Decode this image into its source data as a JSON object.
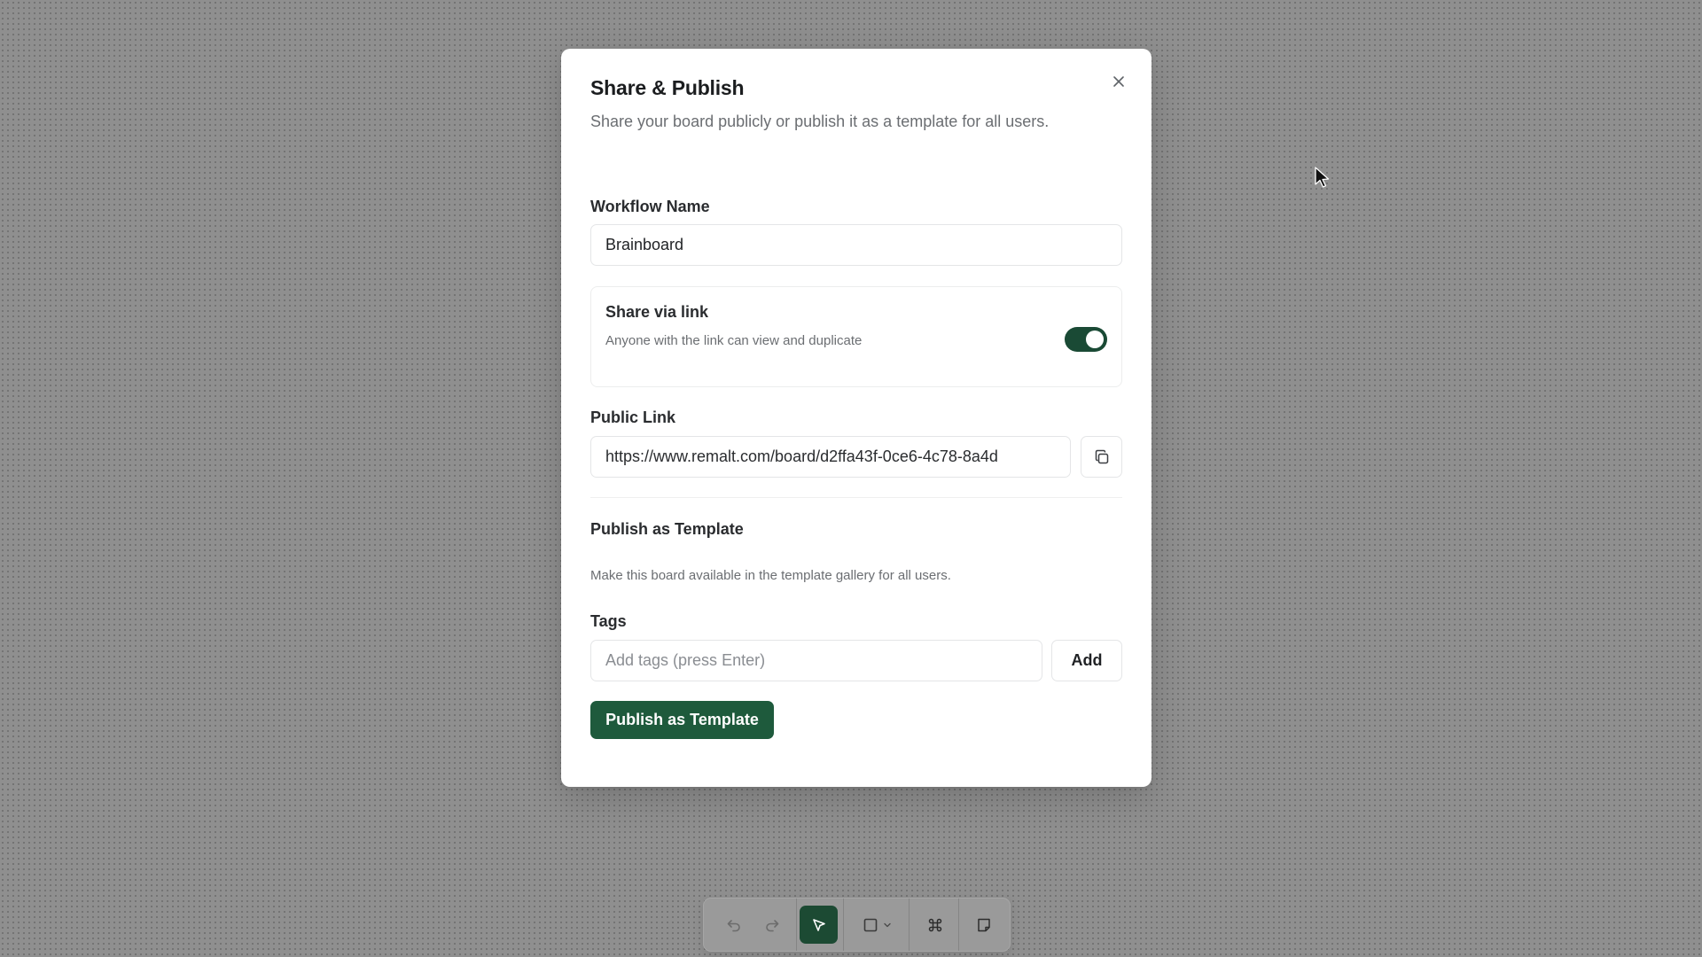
{
  "modal": {
    "title": "Share & Publish",
    "subtitle": "Share your board publicly or publish it as a template for all users.",
    "close_icon": "close-icon"
  },
  "workflow": {
    "label": "Workflow Name",
    "value": "Brainboard"
  },
  "share_link": {
    "title": "Share via link",
    "description": "Anyone with the link can view and duplicate",
    "enabled": true
  },
  "public_link": {
    "label": "Public Link",
    "value": "https://www.remalt.com/board/d2ffa43f-0ce6-4c78-8a4d",
    "copy_icon": "copy-icon"
  },
  "publish_template": {
    "title": "Publish as Template",
    "description": "Make this board available in the template gallery for all users.",
    "tags_label": "Tags",
    "tags_placeholder": "Add tags (press Enter)",
    "add_label": "Add",
    "publish_label": "Publish as Template"
  },
  "toolbar": {
    "tools": [
      "undo-icon",
      "redo-icon",
      "select-pointer-icon",
      "rectangle-shape-icon",
      "chevron-down-icon",
      "command-icon",
      "sticky-note-icon"
    ],
    "active_tool": "select-pointer-icon"
  },
  "colors": {
    "accent": "#1e5a3c",
    "toggle_on": "#1a4a35",
    "backdrop": "#8f8f8f"
  }
}
